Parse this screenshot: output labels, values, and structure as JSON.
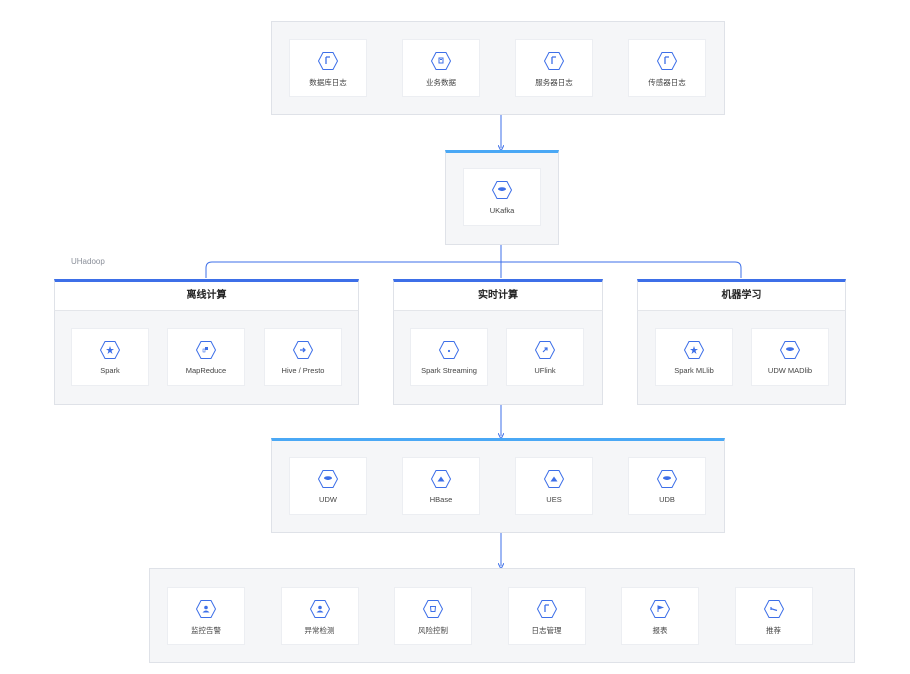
{
  "sources": [
    "数据库日志",
    "业务数据",
    "服务器日志",
    "传感器日志"
  ],
  "kafka": "UKafka",
  "uhadoop_label": "UHadoop",
  "sections": [
    {
      "title": "离线计算",
      "items": [
        "Spark",
        "MapReduce",
        "Hive / Presto"
      ]
    },
    {
      "title": "实时计算",
      "items": [
        "Spark Streaming",
        "UFlink"
      ]
    },
    {
      "title": "机器学习",
      "items": [
        "Spark MLlib",
        "UDW MADlib"
      ]
    }
  ],
  "storage": [
    "UDW",
    "HBase",
    "UES",
    "UDB"
  ],
  "apps": [
    "监控告警",
    "异常检测",
    "风险控制",
    "日志管理",
    "报表",
    "推荐"
  ],
  "colors": {
    "line": "#3d6fe8",
    "accent": "#4aa8f5",
    "icon": "#3d6fe8"
  }
}
